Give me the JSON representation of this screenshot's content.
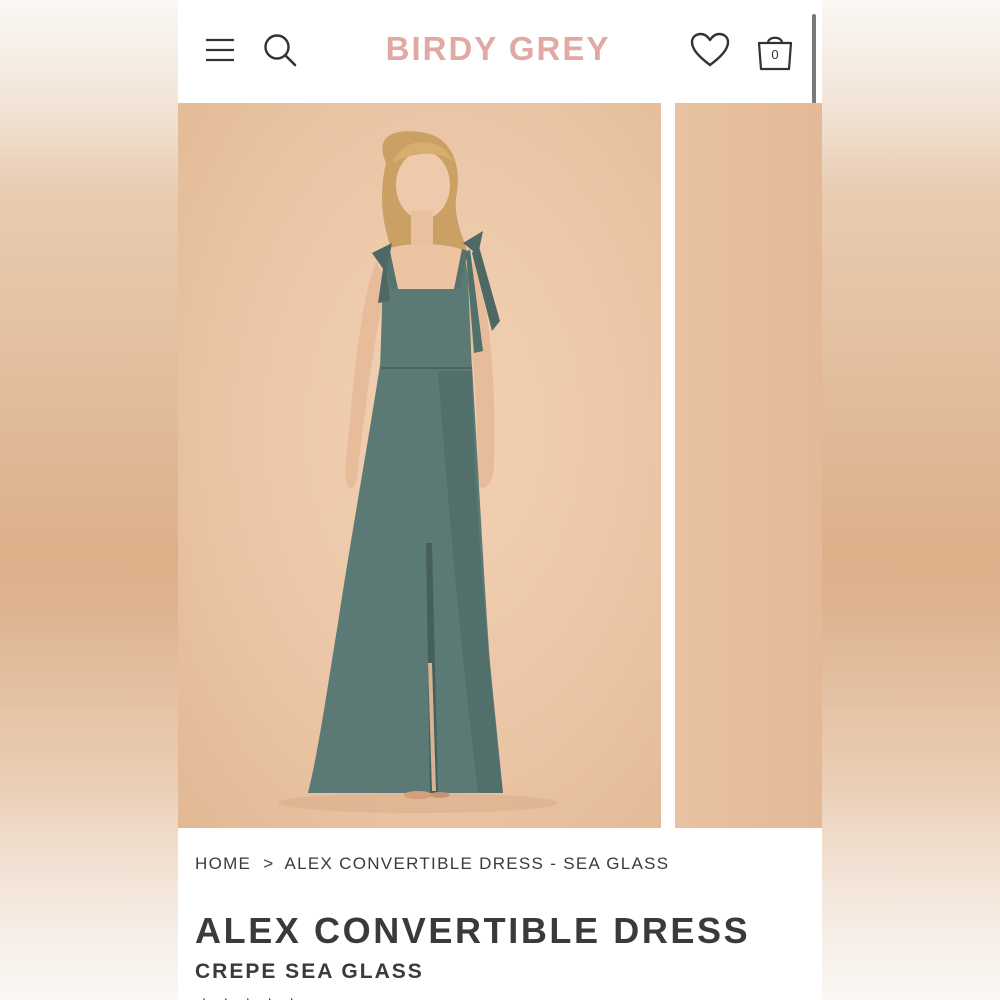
{
  "header": {
    "logo_text": "BIRDY GREY",
    "cart_count": "0",
    "icons": [
      "menu-icon",
      "search-icon",
      "heart-icon",
      "shopping-bag-icon"
    ]
  },
  "gallery": {
    "main_image": "model-in-sea-glass-dress",
    "background_color": "#ebc6a6",
    "dress_color": "#5c7a75"
  },
  "breadcrumb": {
    "home": "HOME",
    "separator": ">",
    "current": "ALEX CONVERTIBLE DRESS - SEA GLASS"
  },
  "product": {
    "title": "ALEX CONVERTIBLE DRESS",
    "subtitle": "CREPE SEA GLASS",
    "stars": "★★★★★"
  },
  "colors": {
    "brand": "#e0a9a4",
    "text": "#3a3a3a"
  }
}
